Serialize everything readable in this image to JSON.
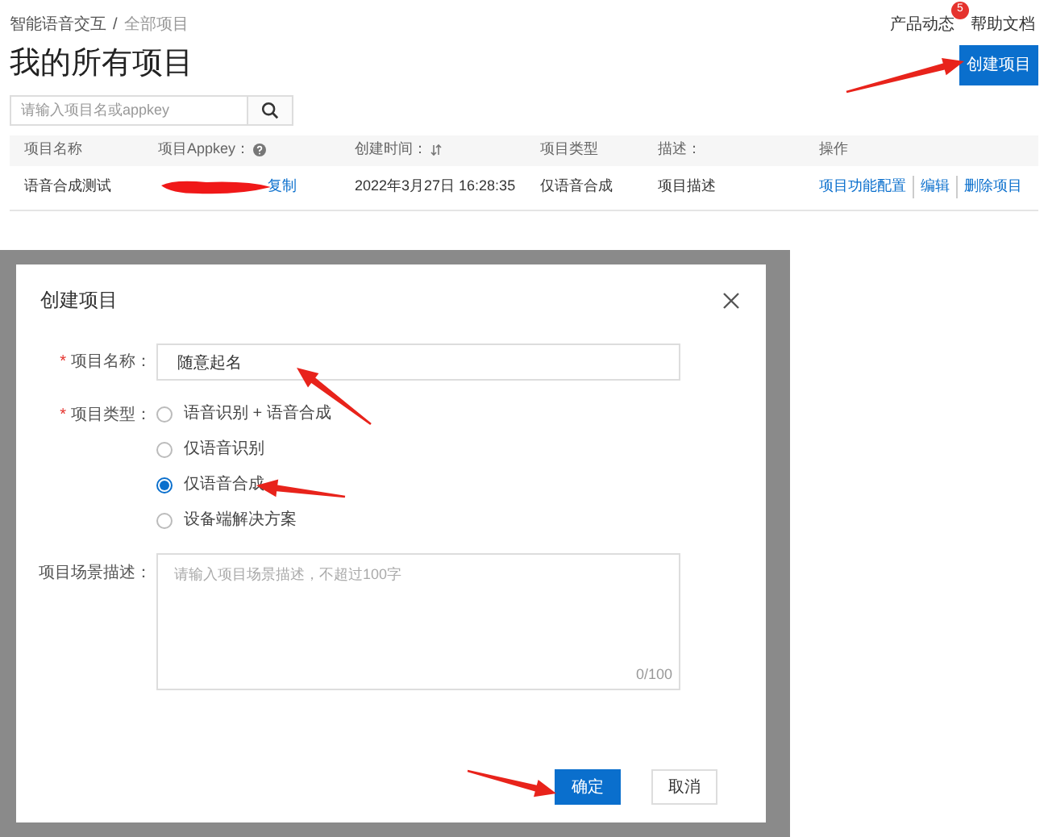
{
  "breadcrumb": [
    "智能语音交互",
    "/",
    "全部项目"
  ],
  "header_links": [
    {
      "label": "产品动态",
      "badge": "5"
    },
    {
      "label": "帮助文档"
    }
  ],
  "page_title": "我的所有项目",
  "create_button": "创建项目",
  "search": {
    "placeholder": "请输入项目名或appkey"
  },
  "table": {
    "columns": [
      {
        "label": "项目名称",
        "kind": "text"
      },
      {
        "label": "项目Appkey：",
        "kind": "help"
      },
      {
        "label": "创建时间：",
        "kind": "sort"
      },
      {
        "label": "项目类型",
        "kind": "text"
      },
      {
        "label": "描述：",
        "kind": "text"
      },
      {
        "label": "操作",
        "kind": "text"
      }
    ],
    "rows": [
      {
        "name": "语音合成测试",
        "appkey_link": "复制",
        "created": "2022年3月27日 16:28:35",
        "type": "仅语音合成",
        "description": "项目描述",
        "actions": [
          "项目功能配置",
          "编辑",
          "删除项目"
        ]
      }
    ]
  },
  "dialog": {
    "title": "创建项目",
    "name_field": {
      "required_mark": "*",
      "label": "项目名称：",
      "value": "随意起名"
    },
    "type_field": {
      "required_mark": "*",
      "label": "项目类型：",
      "options": [
        {
          "label": "语音识别 + 语音合成",
          "selected": false
        },
        {
          "label": "仅语音识别",
          "selected": false
        },
        {
          "label": "仅语音合成",
          "selected": true
        },
        {
          "label": "设备端解决方案",
          "selected": false
        }
      ]
    },
    "description_field": {
      "label": "项目场景描述：",
      "placeholder": "请输入项目场景描述，不超过100字",
      "counter": "0/100"
    },
    "buttons": [
      {
        "label": "确定",
        "kind": "primary"
      },
      {
        "label": "取消",
        "kind": "default"
      }
    ]
  }
}
